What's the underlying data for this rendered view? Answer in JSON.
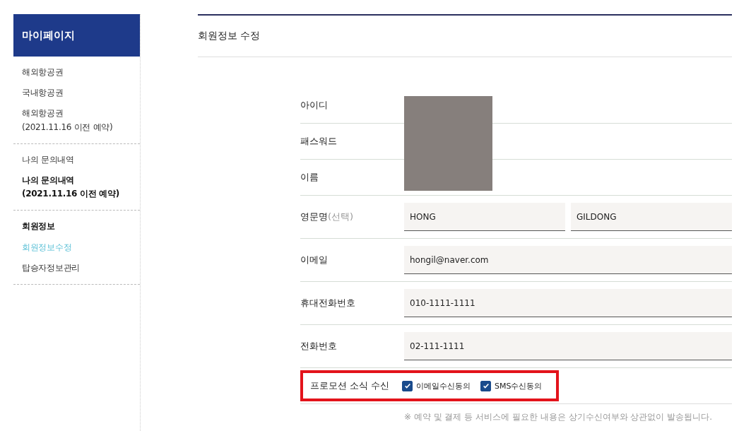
{
  "sidebar": {
    "title": "마이페이지",
    "groups": [
      {
        "items": [
          {
            "label": "해외항공권",
            "bold": false,
            "selected": false
          },
          {
            "label": "국내항공권",
            "bold": false,
            "selected": false
          },
          {
            "label": "해외항공권\n(2021.11.16 이전 예약)",
            "bold": false,
            "selected": false
          }
        ]
      },
      {
        "items": [
          {
            "label": "나의 문의내역",
            "bold": false,
            "selected": false
          },
          {
            "label": "나의 문의내역\n(2021.11.16 이전 예약)",
            "bold": true,
            "selected": false
          }
        ]
      },
      {
        "items": [
          {
            "label": "회원정보",
            "bold": true,
            "selected": false
          },
          {
            "label": "회원정보수정",
            "bold": false,
            "selected": true
          },
          {
            "label": "탑승자정보관리",
            "bold": false,
            "selected": false
          }
        ]
      }
    ]
  },
  "page_title": "회원정보 수정",
  "form": {
    "rows": [
      {
        "kind": "redacted",
        "label": "아이디"
      },
      {
        "kind": "redacted",
        "label": "패스워드"
      },
      {
        "kind": "redacted",
        "label": "이름"
      },
      {
        "kind": "fields",
        "label": "영문명",
        "label_note": "(선택)",
        "values": [
          "HONG",
          "GILDONG"
        ]
      },
      {
        "kind": "fields",
        "label": "이메일",
        "values": [
          "hongil@naver.com"
        ]
      },
      {
        "kind": "fields",
        "label": "휴대전화번호",
        "values": [
          "010-1111-1111"
        ]
      },
      {
        "kind": "fields",
        "label": "전화번호",
        "values": [
          "02-111-1111"
        ]
      },
      {
        "kind": "checks",
        "label": "프로모션 소식 수신",
        "highlighted": true,
        "options": [
          {
            "label": "이메일수신동의",
            "checked": true
          },
          {
            "label": "SMS수신동의",
            "checked": true
          }
        ]
      }
    ],
    "note": "※ 예약 및 결제 등 서비스에 필요한 내용은 상기수신여부와 상관없이 발송됩니다."
  }
}
